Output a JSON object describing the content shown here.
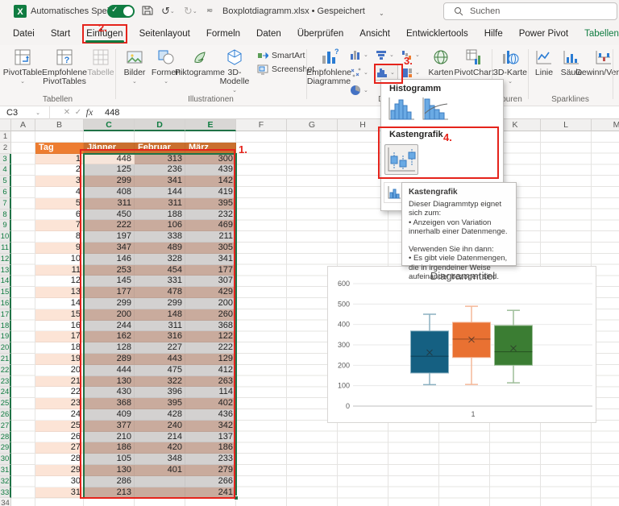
{
  "titlebar": {
    "autosave": "Automatisches Speichern",
    "filename_status": "Boxplotdiagramm.xlsx • Gespeichert",
    "search": "Suchen"
  },
  "tabs": [
    "Datei",
    "Start",
    "Einfügen",
    "Seitenlayout",
    "Formeln",
    "Daten",
    "Überprüfen",
    "Ansicht",
    "Entwicklertools",
    "Hilfe",
    "Power Pivot",
    "Tabellenentwurf"
  ],
  "active_tab": "Einfügen",
  "contextual_tab": "Tabellenentwurf",
  "ribbon": {
    "pivottable": "PivotTable",
    "empfohlene_pivottables": "Empfohlene PivotTables",
    "tabelle": "Tabelle",
    "tabellen_label": "Tabellen",
    "bilder": "Bilder",
    "formen": "Formen",
    "piktogramme": "Piktogramme",
    "modelle3d": "3D-Modelle",
    "smartart": "SmartArt",
    "screenshot": "Screenshot",
    "illustrationen_label": "Illustrationen",
    "empfohlene_diagramme": "Empfohlene Diagramme",
    "karten": "Karten",
    "pivotchart": "PivotChart",
    "diagramme_label": "Diagramme",
    "karte3d": "3D-Karte",
    "touren_label": "Touren",
    "linie": "Linie",
    "saeule": "Säule",
    "gewinn_verlust": "Gewinn/Verlust",
    "sparklines_label": "Sparklines"
  },
  "annotations": {
    "step1": "1.",
    "step2": "2.",
    "step3": "3.",
    "step4": "4."
  },
  "dropdown": {
    "histogramm_label": "Histogramm",
    "kastengrafik_label": "Kastengrafik"
  },
  "tooltip": {
    "title": "Kastengrafik",
    "intro": "Dieser Diagrammtyp eignet sich zum:",
    "bullet1": "• Anzeigen von Variation innerhalb einer Datenmenge.",
    "usage": "Verwenden Sie ihn dann:",
    "bullet2": "• Es gibt viele Datenmengen, die in irgendeiner Weise aufeinander bezogen sind."
  },
  "formula_bar": {
    "name_box": "C3",
    "fx_label": "fx",
    "value": "448"
  },
  "sheet": {
    "visible_columns": [
      "A",
      "B",
      "C",
      "D",
      "E",
      "F",
      "G",
      "H",
      "I",
      "J",
      "K",
      "L",
      "M"
    ],
    "selected_columns": [
      "C",
      "D",
      "E"
    ],
    "first_row": 1,
    "last_row": 34,
    "selected_row_start": 3,
    "selected_row_end": 33,
    "active_cell": "C3",
    "header_row": {
      "tag": "Tag",
      "jan": "Jänner",
      "feb": "Februar",
      "mar": "März"
    },
    "rows": [
      [
        1,
        448,
        313,
        300
      ],
      [
        2,
        125,
        236,
        439
      ],
      [
        3,
        299,
        341,
        142
      ],
      [
        4,
        408,
        144,
        419
      ],
      [
        5,
        311,
        311,
        395
      ],
      [
        6,
        450,
        188,
        232
      ],
      [
        7,
        222,
        106,
        469
      ],
      [
        8,
        197,
        338,
        211
      ],
      [
        9,
        347,
        489,
        305
      ],
      [
        10,
        146,
        328,
        341
      ],
      [
        11,
        253,
        454,
        177
      ],
      [
        12,
        145,
        331,
        307
      ],
      [
        13,
        177,
        478,
        429
      ],
      [
        14,
        299,
        299,
        200
      ],
      [
        15,
        200,
        148,
        260
      ],
      [
        16,
        244,
        311,
        368
      ],
      [
        17,
        162,
        316,
        122
      ],
      [
        18,
        128,
        227,
        222
      ],
      [
        19,
        289,
        443,
        129
      ],
      [
        20,
        444,
        475,
        412
      ],
      [
        21,
        130,
        322,
        263
      ],
      [
        22,
        430,
        396,
        114
      ],
      [
        23,
        368,
        395,
        402
      ],
      [
        24,
        409,
        428,
        436
      ],
      [
        25,
        377,
        240,
        342
      ],
      [
        26,
        210,
        214,
        137
      ],
      [
        27,
        186,
        420,
        186
      ],
      [
        28,
        105,
        348,
        233
      ],
      [
        29,
        130,
        401,
        279
      ],
      [
        30,
        286,
        null,
        266
      ],
      [
        31,
        213,
        null,
        241
      ]
    ]
  },
  "chart_data": {
    "type": "boxplot",
    "title": "Diagrammtitel",
    "x_category": "1",
    "ylim": [
      0,
      600
    ],
    "yticks": [
      0,
      100,
      200,
      300,
      400,
      500,
      600
    ],
    "grid": true,
    "series": [
      {
        "name": "Jänner",
        "color": "#156082",
        "min": 105,
        "q1": 162,
        "median": 244,
        "mean": 262.5,
        "q3": 368,
        "max": 450
      },
      {
        "name": "Februar",
        "color": "#E97132",
        "min": 106,
        "q1": 238,
        "median": 328,
        "mean": 325.5,
        "q3": 410.5,
        "max": 489
      },
      {
        "name": "März",
        "color": "#3B7D33",
        "min": 114,
        "q1": 200,
        "median": 266,
        "mean": 283.2,
        "q3": 395,
        "max": 469
      }
    ]
  }
}
